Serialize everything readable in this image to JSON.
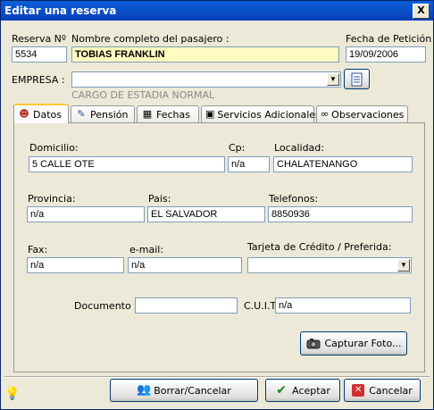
{
  "window": {
    "title": "Editar una reserva",
    "close_glyph": "X"
  },
  "header": {
    "reserva_label": "Reserva Nº",
    "reserva_value": "5534",
    "nombre_label": "Nombre completo del pasajero :",
    "nombre_value": "TOBIAS FRANKLIN",
    "fecha_label": "Fecha de Petición :",
    "fecha_value": "19/09/2006",
    "empresa_label": "EMPRESA :",
    "empresa_value": "",
    "cargo_text": "CARGO DE ESTADIA NORMAL"
  },
  "tabs": [
    {
      "label": "Datos",
      "icon": "person-icon",
      "active": true
    },
    {
      "label": "Pensión",
      "icon": "pen-icon",
      "active": false
    },
    {
      "label": "Fechas",
      "icon": "calendar-icon",
      "active": false
    },
    {
      "label": "Servicios Adicionales",
      "icon": "services-icon",
      "active": false
    },
    {
      "label": "Observaciones",
      "icon": "glasses-icon",
      "active": false
    }
  ],
  "datos": {
    "domicilio_label": "Domicilio:",
    "domicilio_value": "5 CALLE OTE",
    "cp_label": "Cp:",
    "cp_value": "n/a",
    "localidad_label": "Localidad:",
    "localidad_value": "CHALATENANGO",
    "provincia_label": "Provincia:",
    "provincia_value": "n/a",
    "pais_label": "Pais:",
    "pais_value": "EL SALVADOR",
    "telefonos_label": "Telefonos:",
    "telefonos_value": "8850936",
    "fax_label": "Fax:",
    "fax_value": "n/a",
    "email_label": "e-mail:",
    "email_value": "n/a",
    "tarjeta_label": "Tarjeta de Crédito / Preferida:",
    "tarjeta_value": "",
    "documento_label": "Documento :",
    "documento_value": "",
    "cuit_label": "C.U.I.T.",
    "cuit_value": "n/a",
    "capturar_label": "Capturar Foto..."
  },
  "footer": {
    "borrar_label": "Borrar/Cancelar",
    "aceptar_label": "Aceptar",
    "cancelar_label": "Cancelar"
  },
  "colors": {
    "title_bar": "#0a5fd8",
    "name_field_bg": "#fffbc0",
    "tab_highlight": "#ffc83c"
  }
}
